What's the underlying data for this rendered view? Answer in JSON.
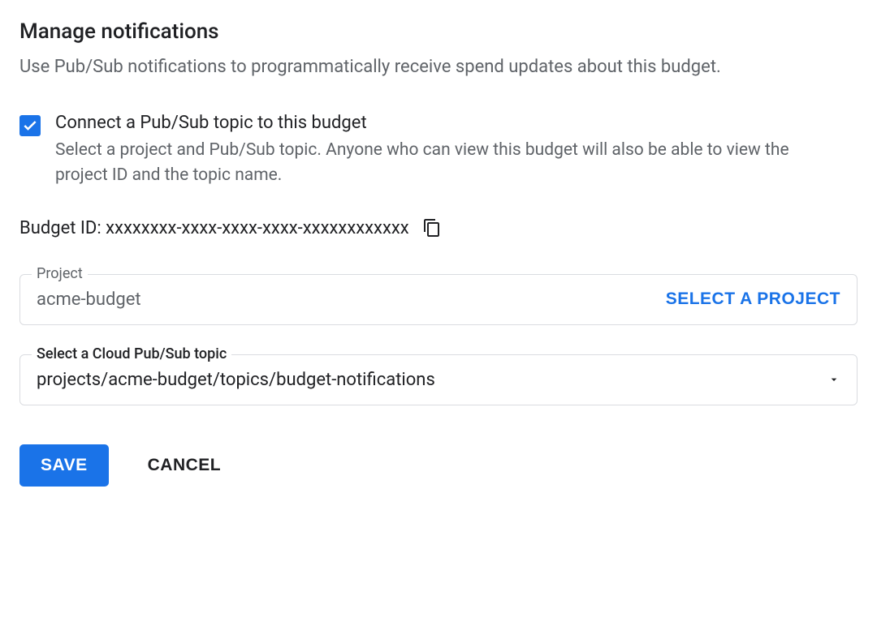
{
  "header": {
    "title": "Manage notifications",
    "description": "Use Pub/Sub notifications to programmatically receive spend updates about this budget."
  },
  "checkbox": {
    "label": "Connect a Pub/Sub topic to this budget",
    "description": "Select a project and Pub/Sub topic. Anyone who can view this budget will also be able to view the project ID and the topic name."
  },
  "budgetId": {
    "label": "Budget ID:",
    "value": "xxxxxxxx-xxxx-xxxx-xxxx-xxxxxxxxxxxx"
  },
  "projectField": {
    "label": "Project",
    "value": "acme-budget",
    "buttonLabel": "SELECT A PROJECT"
  },
  "topicField": {
    "label": "Select a Cloud Pub/Sub topic",
    "value": "projects/acme-budget/topics/budget-notifications"
  },
  "buttons": {
    "save": "SAVE",
    "cancel": "CANCEL"
  }
}
